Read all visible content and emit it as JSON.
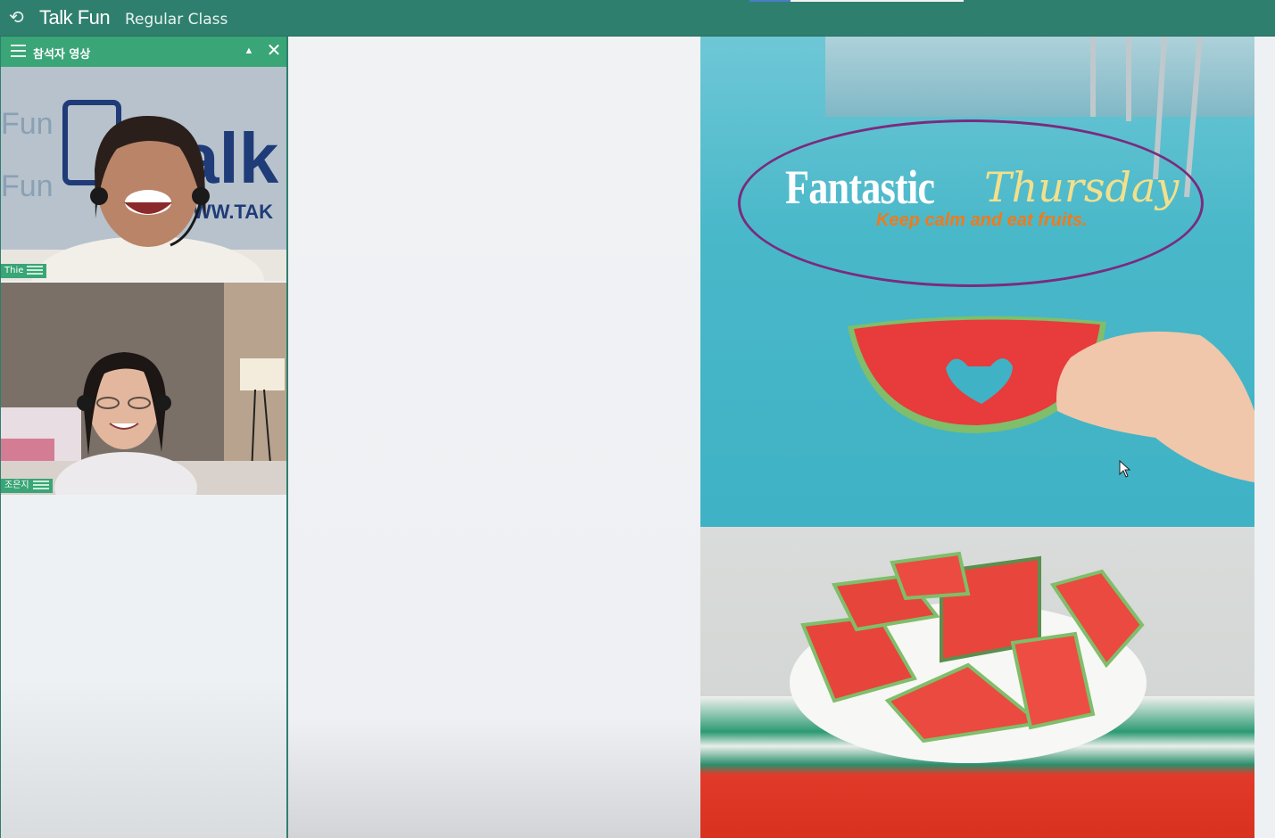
{
  "app": {
    "brand": "Talk Fun",
    "class_name": "Regular Class"
  },
  "participants_panel": {
    "title": "참석자 영상",
    "participants": [
      {
        "name": "Thie"
      },
      {
        "name": "조은지"
      }
    ]
  },
  "slide": {
    "title_main": "Fantastic",
    "title_script": "Thursday",
    "tagline": "Keep calm and eat fruits."
  },
  "colors": {
    "topbar": "#2f7f6e",
    "panel_header": "#3aa577",
    "oval_outline": "#7a2b7f",
    "tagline": "#f07a1c"
  }
}
